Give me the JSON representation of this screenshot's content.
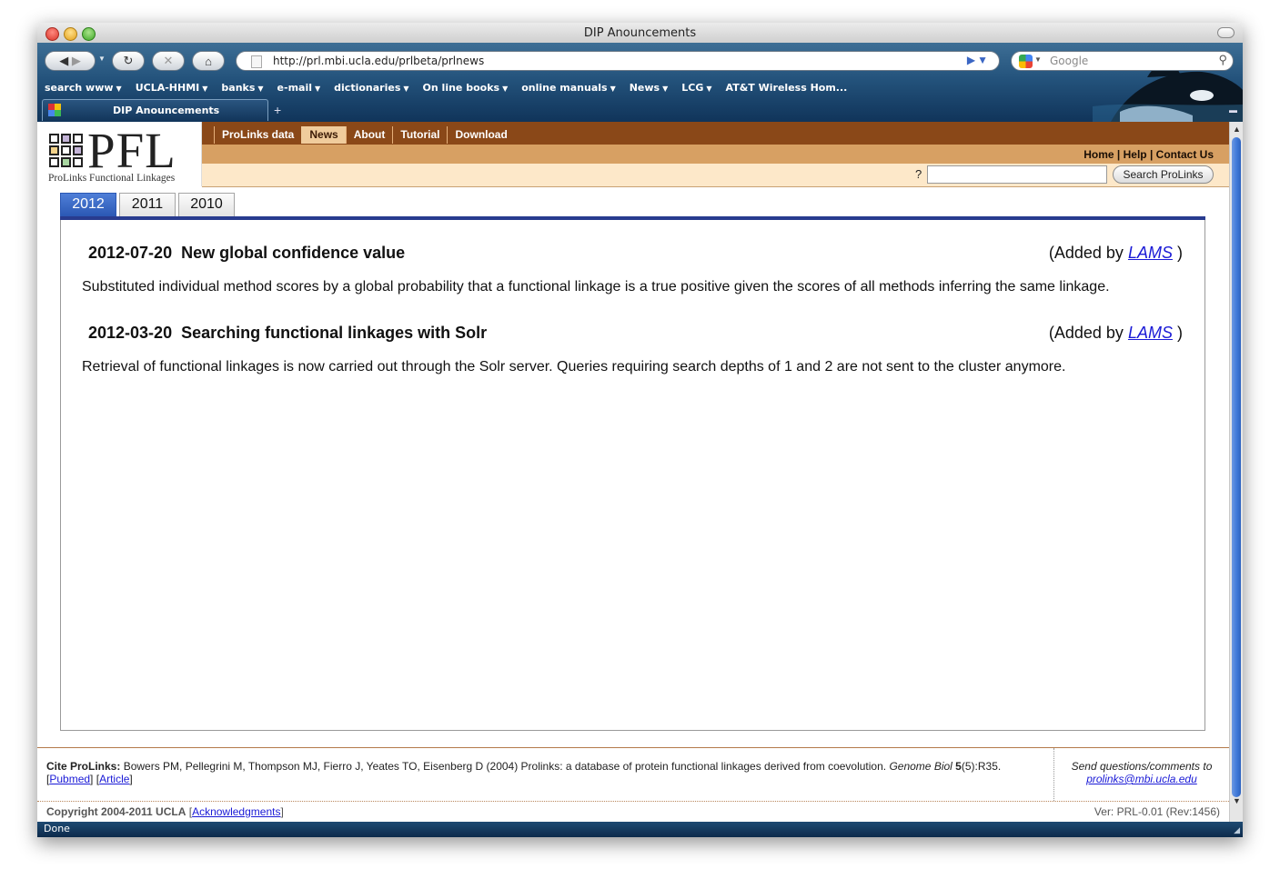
{
  "window": {
    "title": "DIP Anouncements"
  },
  "toolbar": {
    "url": "http://prl.mbi.ucla.edu/prlbeta/prlnews",
    "search_placeholder": "Google"
  },
  "bookmarks": [
    {
      "label": "search www"
    },
    {
      "label": "UCLA-HHMI"
    },
    {
      "label": "banks"
    },
    {
      "label": "e-mail"
    },
    {
      "label": "dictionaries"
    },
    {
      "label": "On line books"
    },
    {
      "label": "online manuals"
    },
    {
      "label": "News"
    },
    {
      "label": "LCG"
    },
    {
      "label": "AT&T Wireless Hom..."
    }
  ],
  "tab": {
    "title": "DIP Anouncements"
  },
  "site": {
    "logo_text": "PFL",
    "logo_subtitle": "ProLinks Functional Linkages",
    "nav": [
      "ProLinks data",
      "News",
      "About",
      "Tutorial",
      "Download"
    ],
    "active_nav": "News",
    "help_links": [
      "Home",
      "Help",
      "Contact Us"
    ],
    "help_sep": " | ",
    "search_help": "?",
    "search_button": "Search ProLinks"
  },
  "years": {
    "tabs": [
      "2012",
      "2011",
      "2010"
    ],
    "active": "2012"
  },
  "news": [
    {
      "date": "2012-07-20",
      "title": "New global confidence value",
      "added_prefix": "(Added by",
      "added_by": "LAMS",
      "added_suffix": ")",
      "body": "Substituted individual method scores by a global probability that a functional linkage is a true positive given the scores of all methods inferring the same linkage."
    },
    {
      "date": "2012-03-20",
      "title": "Searching functional linkages with Solr",
      "added_prefix": "(Added by",
      "added_by": "LAMS",
      "added_suffix": ")",
      "body": "Retrieval of functional linkages is now carried out through the Solr server. Queries requiring search depths of 1 and 2 are not sent to the cluster anymore."
    }
  ],
  "footer": {
    "cite_label": "Cite ProLinks:",
    "cite_text": " Bowers PM, Pellegrini M, Thompson MJ, Fierro J, Yeates TO, Eisenberg D (2004) Prolinks: a database of protein functional linkages derived from coevolution. ",
    "journal": "Genome Biol",
    "volume": "5",
    "issue": "(5):R35.",
    "pubmed": "Pubmed",
    "article": "Article",
    "send_text": "Send questions/comments to",
    "send_email": "prolinks@mbi.ucla.edu",
    "copyright": "Copyright 2004-2011 UCLA",
    "acknowledgments": "Acknowledgments",
    "version": "Ver: PRL-0.01 (Rev:1456)"
  },
  "status": {
    "text": "Done"
  },
  "colors": {
    "nav_brown": "#8a4818",
    "nav_tan": "#d7a063",
    "nav_cream": "#fde8c9",
    "year_active": "#2b58b4",
    "link": "#1a1ad6"
  }
}
